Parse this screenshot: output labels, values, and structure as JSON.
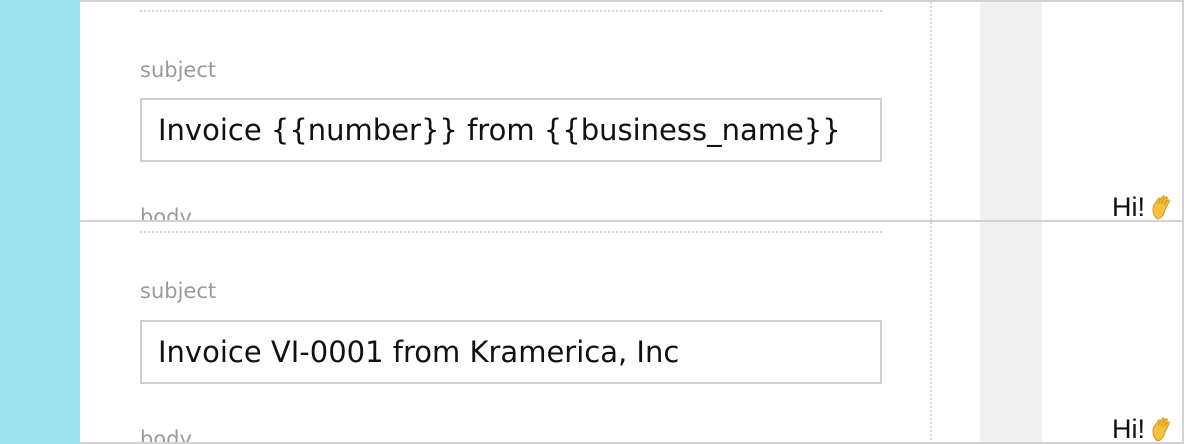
{
  "colors": {
    "sidebar": "#99e3ef",
    "border": "#d2d2d2",
    "label": "#9a9a9a",
    "gutter": "#f0f0f0"
  },
  "template_editor": {
    "subject_label": "subject",
    "subject_value": "Invoice {{number}} from {{business_name}}",
    "body_label": "body",
    "preview_greeting": "Hi!",
    "greeting_icon": "waving-hand-icon"
  },
  "rendered_preview": {
    "subject_label": "subject",
    "subject_value": "Invoice VI-0001 from Kramerica, Inc",
    "body_label": "body",
    "preview_greeting": "Hi!",
    "greeting_icon": "waving-hand-icon"
  }
}
